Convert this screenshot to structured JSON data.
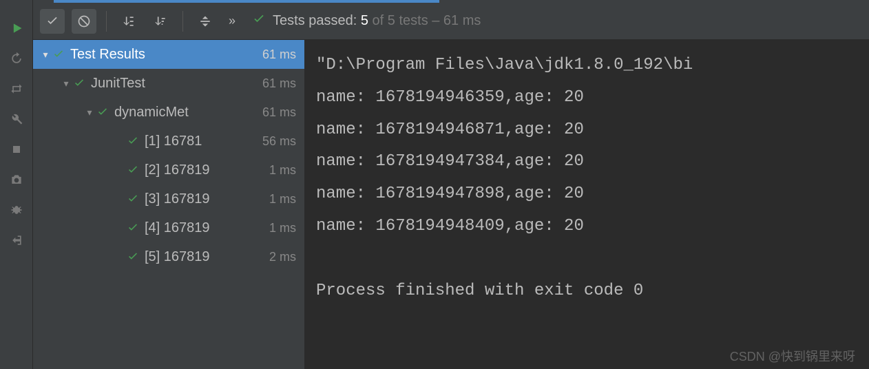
{
  "status": {
    "prefix": "Tests passed: ",
    "count": "5",
    "rest": " of 5 tests – 61 ms"
  },
  "tree": {
    "root": {
      "label": "Test Results",
      "time": "61 ms"
    },
    "suite": {
      "label": "JunitTest",
      "time": "61 ms"
    },
    "method": {
      "label": "dynamicMet",
      "time": "61 ms"
    },
    "items": [
      {
        "label": "[1] 16781",
        "time": "56 ms"
      },
      {
        "label": "[2] 167819",
        "time": "1 ms"
      },
      {
        "label": "[3] 167819",
        "time": "1 ms"
      },
      {
        "label": "[4] 167819",
        "time": "1 ms"
      },
      {
        "label": "[5] 167819",
        "time": "2 ms"
      }
    ]
  },
  "console": {
    "line0": "\"D:\\Program Files\\Java\\jdk1.8.0_192\\bi",
    "line1": "name: 1678194946359,age: 20",
    "line2": "name: 1678194946871,age: 20",
    "line3": "name: 1678194947384,age: 20",
    "line4": "name: 1678194947898,age: 20",
    "line5": "name: 1678194948409,age: 20",
    "blank": "",
    "line6": "Process finished with exit code 0"
  },
  "watermark": "CSDN @快到锅里来呀"
}
